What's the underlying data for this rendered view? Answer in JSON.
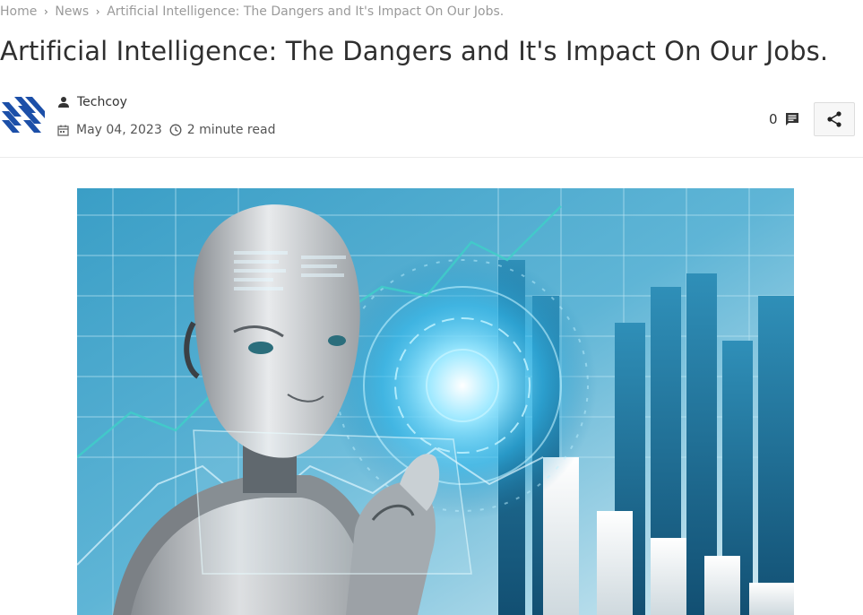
{
  "breadcrumb": {
    "home": "Home",
    "section": "News",
    "current": "Artificial Intelligence: The Dangers and It's Impact On Our Jobs."
  },
  "article": {
    "title": "Artificial Intelligence: The Dangers and It's Impact On Our Jobs.",
    "author": "Techcoy",
    "date": "May 04, 2023",
    "read_time": "2 minute read",
    "comment_count": "0"
  },
  "icons": {
    "breadcrumb_separator": "chevron-right-icon",
    "author": "user-icon",
    "date": "calendar-icon",
    "read_time": "clock-icon",
    "comments": "comment-icon",
    "share": "share-icon"
  },
  "colors": {
    "logo_blue": "#1c4fa8",
    "title_text": "#2f2f2f",
    "breadcrumb_text": "#9a9a9a",
    "hero_bg": "#2e8fb5"
  }
}
